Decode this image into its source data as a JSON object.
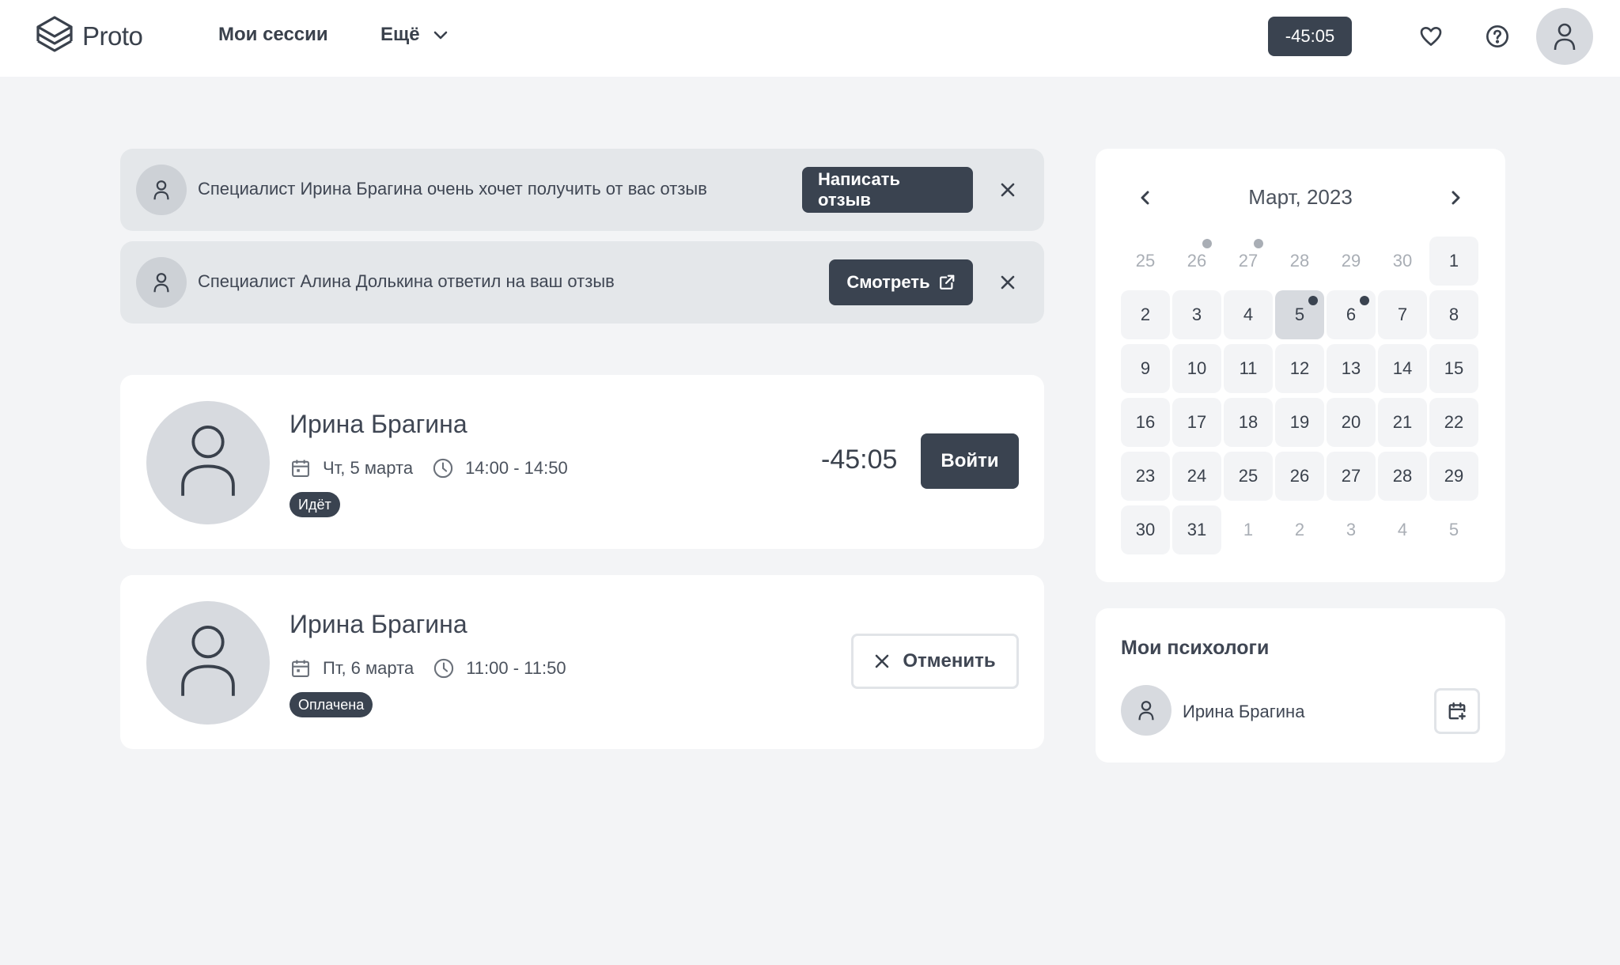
{
  "header": {
    "logo_text": "Proto",
    "nav": {
      "sessions": "Мои сессии",
      "more": "Ещё"
    },
    "timer": "-45:05"
  },
  "notifications": [
    {
      "text": "Специалист Ирина Брагина очень хочет получить от вас отзыв",
      "button": "Написать отзыв"
    },
    {
      "text": "Специалист Алина Долькина ответил на ваш отзыв",
      "button": "Смотреть"
    }
  ],
  "sessions": [
    {
      "name": "Ирина Брагина",
      "date": "Чт, 5 марта",
      "time": "14:00 - 14:50",
      "status": "Идёт",
      "timer": "-45:05",
      "action": "Войти"
    },
    {
      "name": "Ирина Брагина",
      "date": "Пт, 6 марта",
      "time": "11:00 - 11:50",
      "status": "Оплачена",
      "action": "Отменить"
    }
  ],
  "calendar": {
    "title": "Март, 2023",
    "days": [
      {
        "d": "25",
        "other": true
      },
      {
        "d": "26",
        "other": true,
        "dot": true
      },
      {
        "d": "27",
        "other": true,
        "dot": true
      },
      {
        "d": "28",
        "other": true
      },
      {
        "d": "29",
        "other": true
      },
      {
        "d": "30",
        "other": true
      },
      {
        "d": "1"
      },
      {
        "d": "2"
      },
      {
        "d": "3"
      },
      {
        "d": "4"
      },
      {
        "d": "5",
        "selected": true,
        "dot": true
      },
      {
        "d": "6",
        "dot": true
      },
      {
        "d": "7"
      },
      {
        "d": "8"
      },
      {
        "d": "9"
      },
      {
        "d": "10"
      },
      {
        "d": "11"
      },
      {
        "d": "12"
      },
      {
        "d": "13"
      },
      {
        "d": "14"
      },
      {
        "d": "15"
      },
      {
        "d": "16"
      },
      {
        "d": "17"
      },
      {
        "d": "18"
      },
      {
        "d": "19"
      },
      {
        "d": "20"
      },
      {
        "d": "21"
      },
      {
        "d": "22"
      },
      {
        "d": "23"
      },
      {
        "d": "24"
      },
      {
        "d": "25"
      },
      {
        "d": "26"
      },
      {
        "d": "27"
      },
      {
        "d": "28"
      },
      {
        "d": "29"
      },
      {
        "d": "30"
      },
      {
        "d": "31"
      },
      {
        "d": "1",
        "other": true
      },
      {
        "d": "2",
        "other": true
      },
      {
        "d": "3",
        "other": true
      },
      {
        "d": "4",
        "other": true
      },
      {
        "d": "5",
        "other": true
      }
    ]
  },
  "psychologists": {
    "title": "Мои психологи",
    "items": [
      {
        "name": "Ирина Брагина"
      }
    ]
  }
}
